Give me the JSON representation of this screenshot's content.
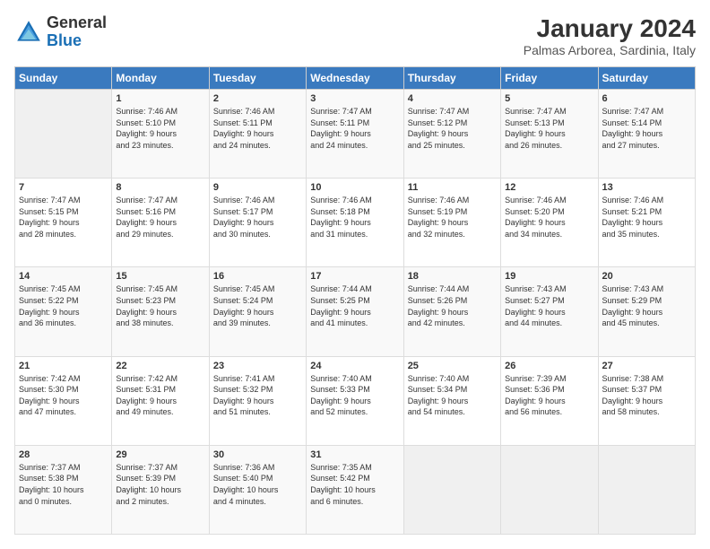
{
  "header": {
    "logo_general": "General",
    "logo_blue": "Blue",
    "month_title": "January 2024",
    "location": "Palmas Arborea, Sardinia, Italy"
  },
  "days_of_week": [
    "Sunday",
    "Monday",
    "Tuesday",
    "Wednesday",
    "Thursday",
    "Friday",
    "Saturday"
  ],
  "weeks": [
    [
      {
        "day": "",
        "info": ""
      },
      {
        "day": "1",
        "info": "Sunrise: 7:46 AM\nSunset: 5:10 PM\nDaylight: 9 hours\nand 23 minutes."
      },
      {
        "day": "2",
        "info": "Sunrise: 7:46 AM\nSunset: 5:11 PM\nDaylight: 9 hours\nand 24 minutes."
      },
      {
        "day": "3",
        "info": "Sunrise: 7:47 AM\nSunset: 5:11 PM\nDaylight: 9 hours\nand 24 minutes."
      },
      {
        "day": "4",
        "info": "Sunrise: 7:47 AM\nSunset: 5:12 PM\nDaylight: 9 hours\nand 25 minutes."
      },
      {
        "day": "5",
        "info": "Sunrise: 7:47 AM\nSunset: 5:13 PM\nDaylight: 9 hours\nand 26 minutes."
      },
      {
        "day": "6",
        "info": "Sunrise: 7:47 AM\nSunset: 5:14 PM\nDaylight: 9 hours\nand 27 minutes."
      }
    ],
    [
      {
        "day": "7",
        "info": "Sunrise: 7:47 AM\nSunset: 5:15 PM\nDaylight: 9 hours\nand 28 minutes."
      },
      {
        "day": "8",
        "info": "Sunrise: 7:47 AM\nSunset: 5:16 PM\nDaylight: 9 hours\nand 29 minutes."
      },
      {
        "day": "9",
        "info": "Sunrise: 7:46 AM\nSunset: 5:17 PM\nDaylight: 9 hours\nand 30 minutes."
      },
      {
        "day": "10",
        "info": "Sunrise: 7:46 AM\nSunset: 5:18 PM\nDaylight: 9 hours\nand 31 minutes."
      },
      {
        "day": "11",
        "info": "Sunrise: 7:46 AM\nSunset: 5:19 PM\nDaylight: 9 hours\nand 32 minutes."
      },
      {
        "day": "12",
        "info": "Sunrise: 7:46 AM\nSunset: 5:20 PM\nDaylight: 9 hours\nand 34 minutes."
      },
      {
        "day": "13",
        "info": "Sunrise: 7:46 AM\nSunset: 5:21 PM\nDaylight: 9 hours\nand 35 minutes."
      }
    ],
    [
      {
        "day": "14",
        "info": "Sunrise: 7:45 AM\nSunset: 5:22 PM\nDaylight: 9 hours\nand 36 minutes."
      },
      {
        "day": "15",
        "info": "Sunrise: 7:45 AM\nSunset: 5:23 PM\nDaylight: 9 hours\nand 38 minutes."
      },
      {
        "day": "16",
        "info": "Sunrise: 7:45 AM\nSunset: 5:24 PM\nDaylight: 9 hours\nand 39 minutes."
      },
      {
        "day": "17",
        "info": "Sunrise: 7:44 AM\nSunset: 5:25 PM\nDaylight: 9 hours\nand 41 minutes."
      },
      {
        "day": "18",
        "info": "Sunrise: 7:44 AM\nSunset: 5:26 PM\nDaylight: 9 hours\nand 42 minutes."
      },
      {
        "day": "19",
        "info": "Sunrise: 7:43 AM\nSunset: 5:27 PM\nDaylight: 9 hours\nand 44 minutes."
      },
      {
        "day": "20",
        "info": "Sunrise: 7:43 AM\nSunset: 5:29 PM\nDaylight: 9 hours\nand 45 minutes."
      }
    ],
    [
      {
        "day": "21",
        "info": "Sunrise: 7:42 AM\nSunset: 5:30 PM\nDaylight: 9 hours\nand 47 minutes."
      },
      {
        "day": "22",
        "info": "Sunrise: 7:42 AM\nSunset: 5:31 PM\nDaylight: 9 hours\nand 49 minutes."
      },
      {
        "day": "23",
        "info": "Sunrise: 7:41 AM\nSunset: 5:32 PM\nDaylight: 9 hours\nand 51 minutes."
      },
      {
        "day": "24",
        "info": "Sunrise: 7:40 AM\nSunset: 5:33 PM\nDaylight: 9 hours\nand 52 minutes."
      },
      {
        "day": "25",
        "info": "Sunrise: 7:40 AM\nSunset: 5:34 PM\nDaylight: 9 hours\nand 54 minutes."
      },
      {
        "day": "26",
        "info": "Sunrise: 7:39 AM\nSunset: 5:36 PM\nDaylight: 9 hours\nand 56 minutes."
      },
      {
        "day": "27",
        "info": "Sunrise: 7:38 AM\nSunset: 5:37 PM\nDaylight: 9 hours\nand 58 minutes."
      }
    ],
    [
      {
        "day": "28",
        "info": "Sunrise: 7:37 AM\nSunset: 5:38 PM\nDaylight: 10 hours\nand 0 minutes."
      },
      {
        "day": "29",
        "info": "Sunrise: 7:37 AM\nSunset: 5:39 PM\nDaylight: 10 hours\nand 2 minutes."
      },
      {
        "day": "30",
        "info": "Sunrise: 7:36 AM\nSunset: 5:40 PM\nDaylight: 10 hours\nand 4 minutes."
      },
      {
        "day": "31",
        "info": "Sunrise: 7:35 AM\nSunset: 5:42 PM\nDaylight: 10 hours\nand 6 minutes."
      },
      {
        "day": "",
        "info": ""
      },
      {
        "day": "",
        "info": ""
      },
      {
        "day": "",
        "info": ""
      }
    ]
  ]
}
